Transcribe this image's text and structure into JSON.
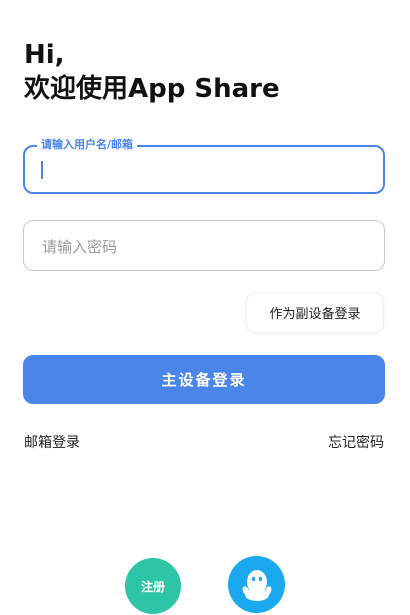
{
  "header": {
    "greeting_line1": "Hi,",
    "greeting_line2": "欢迎使用App Share"
  },
  "login_form": {
    "username_label": "请输入用户名/邮箱",
    "username_value": "",
    "password_placeholder": "请输入密码",
    "password_value": "",
    "secondary_login_label": "作为副设备登录",
    "primary_login_label": "主设备登录"
  },
  "links": {
    "email_login": "邮箱登录",
    "forgot_password": "忘记密码"
  },
  "bottom_actions": {
    "register_label": "注册",
    "qq_icon": "qq-penguin-icon"
  },
  "colors": {
    "accent": "#4a86ea",
    "register": "#2ec4a6",
    "qq": "#1aa8ee"
  }
}
